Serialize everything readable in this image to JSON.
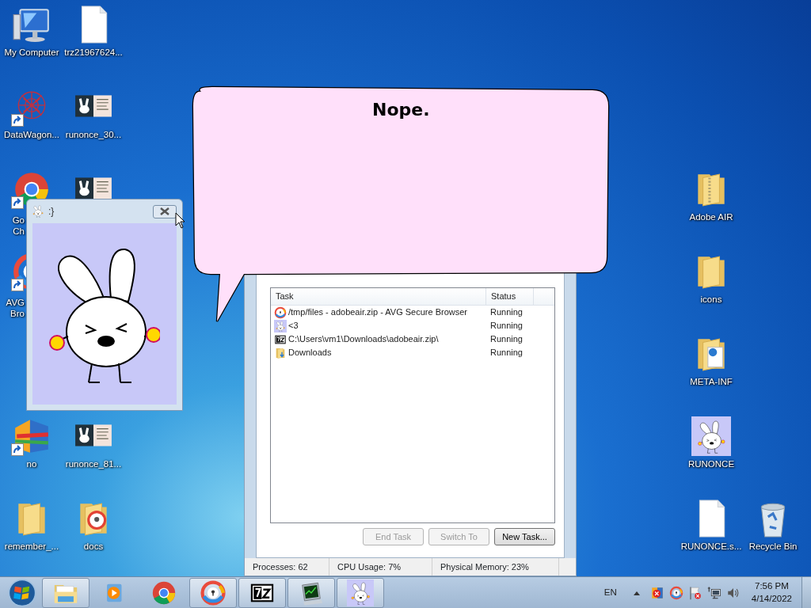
{
  "desktop": {
    "columns": [
      [
        {
          "label": "My Computer",
          "kind": "computer",
          "shortcut": false
        },
        {
          "label": "DataWagon...",
          "kind": "web",
          "shortcut": true
        },
        {
          "label": "Go Ch",
          "kind": "browser",
          "shortcut": true
        },
        {
          "label": "AVG Bro",
          "kind": "shield-browser",
          "shortcut": true
        },
        {
          "label": "no",
          "kind": "grid-app",
          "shortcut": true
        },
        {
          "label": "remember_...",
          "kind": "folder",
          "shortcut": false
        }
      ],
      [
        {
          "label": "trz21967624...",
          "kind": "document",
          "shortcut": false
        },
        {
          "label": "runonce_30...",
          "kind": "thumbnail",
          "shortcut": false
        },
        {
          "kind": "thumbnail",
          "shortcut": false
        },
        {
          "label": "runonce_81...",
          "kind": "thumbnail",
          "shortcut": false
        },
        {
          "label": "docs",
          "kind": "lock-folder",
          "shortcut": false
        }
      ],
      [
        {
          "label": "Adobe AIR",
          "kind": "zip-folder",
          "shortcut": false
        },
        {
          "label": "icons",
          "kind": "folder",
          "shortcut": false
        },
        {
          "label": "META-INF",
          "kind": "doc-folder",
          "shortcut": false
        },
        {
          "label": "RUNONCE",
          "kind": "bunny",
          "shortcut": false
        },
        {
          "label": "RUNONCE.s...",
          "kind": "document",
          "shortcut": false
        }
      ],
      [
        {
          "label": "Recycle Bin",
          "kind": "recycle",
          "shortcut": false
        }
      ]
    ]
  },
  "task_manager": {
    "columns": [
      "Task",
      "Status"
    ],
    "rows": [
      {
        "kind": "shield-browser",
        "task": "/tmp/files - adobeair.zip - AVG Secure Browser",
        "status": "Running"
      },
      {
        "kind": "bunny",
        "task": "<3",
        "status": "Running"
      },
      {
        "kind": "archive",
        "task": "C:\\Users\\vm1\\Downloads\\adobeair.zip\\",
        "status": "Running"
      },
      {
        "kind": "download-folder",
        "task": "Downloads",
        "status": "Running"
      }
    ],
    "buttons": [
      {
        "label": "End Task",
        "disabled": true
      },
      {
        "label": "Switch To",
        "disabled": true
      },
      {
        "label": "New Task...",
        "disabled": false
      }
    ],
    "status_bar": [
      "Processes: 62",
      "CPU Usage: 7%",
      "Physical Memory: 23%"
    ]
  },
  "popup_window": {
    "title": ":}"
  },
  "speech_bubble": {
    "text": "Nope."
  },
  "taskbar": {
    "items": [
      {
        "kind": "explorer",
        "running": true
      },
      {
        "kind": "media",
        "running": false
      },
      {
        "kind": "browser",
        "running": false
      },
      {
        "kind": "shield-browser",
        "running": true
      },
      {
        "kind": "archive",
        "running": true
      },
      {
        "kind": "monitor",
        "running": true
      },
      {
        "kind": "bunny",
        "running": true
      }
    ],
    "language": "EN",
    "tray_icons": [
      {
        "kind": "blocked-app"
      },
      {
        "kind": "shield-browser"
      },
      {
        "kind": "flag"
      },
      {
        "kind": "network"
      },
      {
        "kind": "speaker"
      }
    ],
    "time": "7:56 PM",
    "date": "4/14/2022"
  }
}
